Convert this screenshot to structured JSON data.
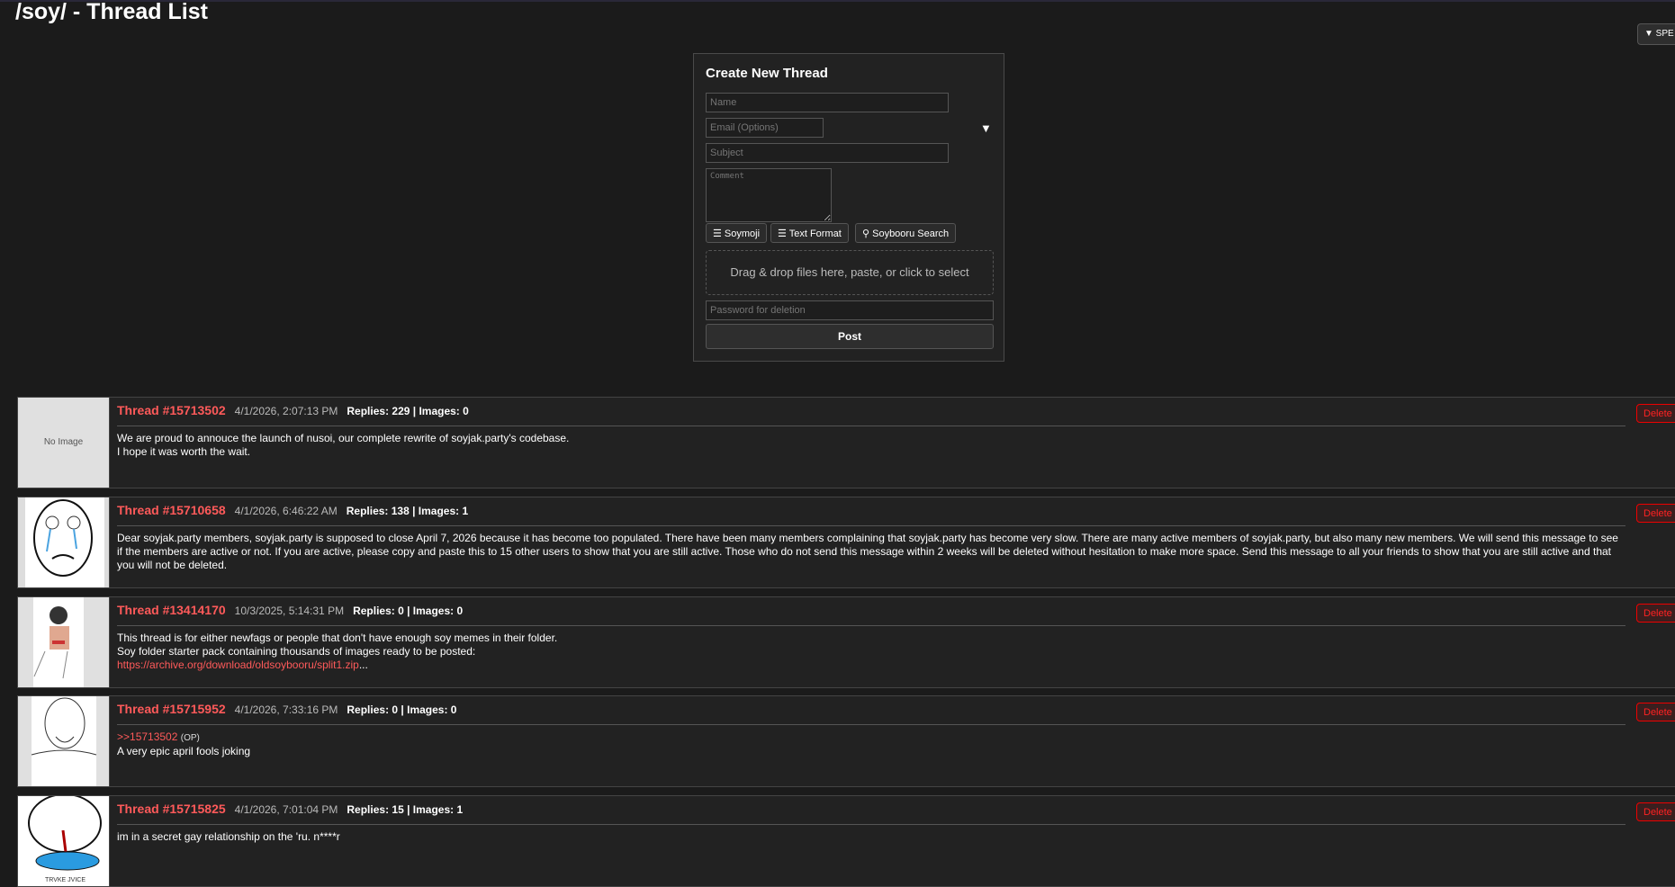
{
  "page": {
    "title": "/soy/ - Thread List",
    "spe_button": "▼ SPE M"
  },
  "form": {
    "title": "Create New Thread",
    "name_placeholder": "Name",
    "email_placeholder": "Email (Options)",
    "email_dropdown_icon": "▼",
    "subject_placeholder": "Subject",
    "comment_placeholder": "Comment",
    "buttons": [
      "☰ Soymoji",
      "☰ Text Format",
      "⚲ Soybooru Search"
    ],
    "dropzone": "Drag & drop files here, paste, or click to select",
    "password_placeholder": "Password for deletion",
    "post_label": "Post"
  },
  "accent_color": "#ff5a5a",
  "threads": [
    {
      "num": "Thread #15713502",
      "date": "4/1/2026, 2:07:13 PM",
      "stats": "Replies: 229 | Images: 0",
      "thumb": "No Image",
      "lines": [
        "We are proud to annouce the launch of nusoi, our complete rewrite of soyjak.party's codebase.",
        "I hope it was worth the wait."
      ],
      "delete": "Delete"
    },
    {
      "num": "Thread #15710658",
      "date": "4/1/2026, 6:46:22 AM",
      "stats": "Replies: 138 | Images: 1",
      "lines": [
        "Dear soyjak.party members, soyjak.party is supposed to close April 7, 2026 because it has become too populated. There have been many members complaining that soyjak.party has become very slow. There are many active members of soyjak.party, but also many new members. We will send this message to see if the members are active or not. If you are active, please copy and paste this to 15 other users to show that you are still active. Those who do not send this message within 2 weeks will be deleted without hesitation to make more space. Send this message to all your friends to show that you are still active and that you will not be deleted."
      ],
      "delete": "Delete"
    },
    {
      "num": "Thread #13414170",
      "date": "10/3/2025, 5:14:31 PM",
      "stats": "Replies: 0 | Images: 0",
      "lines": [
        "This thread is for either newfags or people that don't have enough soy memes in their folder.",
        "Soy folder starter pack containing thousands of images ready to be posted:"
      ],
      "link": "https://archive.org/download/oldsoybooru/split1.zip",
      "ellipsis": "...",
      "delete": "Delete"
    },
    {
      "num": "Thread #15715952",
      "date": "4/1/2026, 7:33:16 PM",
      "stats": "Replies: 0 | Images: 0",
      "quote": ">>15713502",
      "quote_tag": "(OP)",
      "lines": [
        "A very epic april fools joking"
      ],
      "delete": "Delete"
    },
    {
      "num": "Thread #15715825",
      "date": "4/1/2026, 7:01:04 PM",
      "stats": "Replies: 15 | Images: 1",
      "lines": [
        "im in a secret gay relationship on the 'ru. n****r"
      ],
      "thumb_caption": "TRVKE JVICE",
      "delete": "Delete"
    }
  ]
}
